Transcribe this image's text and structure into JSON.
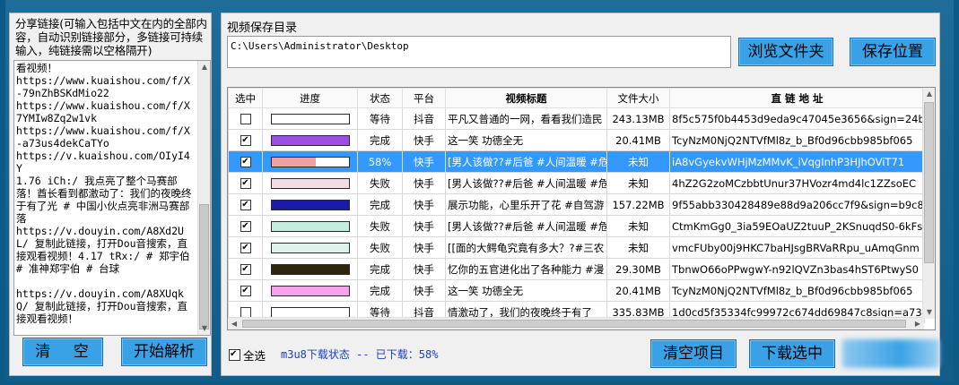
{
  "left": {
    "caption": "分享链接(可输入包括中文在内的全部内容，自动识别链接部分，多链接可持续输入，纯链接需以空格隔开)",
    "text": "看视频！\nhttps://www.kuaishou.com/f/X-79nZhBSKdMio22\nhttps://www.kuaishou.com/f/X7YMIw8Zq2w1vk\nhttps://www.kuaishou.com/f/X-a73us4dekCaTYo\nhttps://v.kuaishou.com/OIyI4Y\n1.76 iCh:/ 我点亮了整个马赛部落！酋长看到都激动了：我们的夜晚终于有了光 # 中国小伙点亮非洲马赛部落\nhttps://v.douyin.com/A8Xd2UL/ 复制此链接，打开Dou音搜索，直接观看视频！4.17 tRx:/ # 郑宇伯 # 准神郑宇伯 # 台球\n\nhttps://v.douyin.com/A8XUqkQ/ 复制此链接，打开Dou音搜索，直接观看视频！",
    "clear_label": "清 空",
    "parse_label": "开始解析"
  },
  "right": {
    "save_label": "视频保存目录",
    "save_path": "C:\\Users\\Administrator\\Desktop",
    "browse_label": "浏览文件夹",
    "savepos_label": "保存位置",
    "columns": [
      "选中",
      "进度",
      "状态",
      "平台",
      "视频标题",
      "文件大小",
      "直 链 地 址"
    ],
    "rows": [
      {
        "checked": false,
        "progress": 0,
        "bar_color": "#f5f5f5",
        "status": "等待",
        "platform": "抖音",
        "title": "平凡又普通的一网，看看我们造民",
        "size": "243.13MB",
        "url": "8f5c575f0b4453d9eda9c47045e3656&sign=24b"
      },
      {
        "checked": true,
        "progress": 100,
        "bar_color": "#9b4fe6",
        "status": "完成",
        "platform": "快手",
        "title": "这一笑 功德全无",
        "size": "20.41MB",
        "url": "TcyNzM0NjQ2NTVfMl8z_b_Bf0d96cbb985bf065"
      },
      {
        "checked": true,
        "progress": 58,
        "bar_color": "#f0a0a0",
        "status": "58%",
        "platform": "快手",
        "title": "[男人该做??#后爸 #人间温暖 #危",
        "size": "未知",
        "url": "iA8vGyekvWHjMzMMvK_iVqgInhP3HJhOViT71",
        "selected": true
      },
      {
        "checked": true,
        "progress": 100,
        "bar_color": "#f0dde6",
        "status": "失败",
        "platform": "快手",
        "title": "[男人该做??#后爸 #人间温暖 #危",
        "size": "未知",
        "url": "4hZ2G2zoMCzbbtUnur37HVozr4md4lc1ZZsoEC"
      },
      {
        "checked": true,
        "progress": 100,
        "bar_color": "#1c1aa8",
        "status": "完成",
        "platform": "快手",
        "title": "展示功能，心里乐开了花 #自驾游",
        "size": "157.22MB",
        "url": "9f55abb330428489e88d9a206cc7f9&sign=b9c8"
      },
      {
        "checked": true,
        "progress": 100,
        "bar_color": "#c4ece0",
        "status": "失败",
        "platform": "快手",
        "title": "[男人该做??#后爸 #人间温暖 #危",
        "size": "未知",
        "url": "CtmKmGg0_3ia59EOaUZ2tuuP_2KSnuqdS0-6kFsa"
      },
      {
        "checked": true,
        "progress": 100,
        "bar_color": "#dff2ea",
        "status": "失败",
        "platform": "快手",
        "title": "[[面的大鳄龟究竟有多大？?#三农",
        "size": "未知",
        "url": "vmcFUby00j9HKC7baHJsgBRVaRRpu_uAmqGnm"
      },
      {
        "checked": true,
        "progress": 100,
        "bar_color": "#2e2410",
        "status": "完成",
        "platform": "快手",
        "title": "忆你的五官进化出了各种能力 #漫",
        "size": "29.30MB",
        "url": "TbnwO66oPPwgwY-n92lQVZn3bas4hST6PtwyS0"
      },
      {
        "checked": true,
        "progress": 100,
        "bar_color": "#f6a0ee",
        "status": "完成",
        "platform": "快手",
        "title": "这一笑 功德全无",
        "size": "20.41MB",
        "url": "TcyNzM0NjQ2NTVfMl8z_b_Bf0d96cbb985bf065"
      },
      {
        "checked": false,
        "progress": 0,
        "bar_color": "#f5f5f5",
        "status": "等待",
        "platform": "抖音",
        "title": "情激动了，我们的夜晚终于有了",
        "size": "335.83MB",
        "url": "1d0cd5f35334fc99972c674dd69847c8sign=a73e"
      }
    ],
    "select_all_label": "全选",
    "status_text": "m3u8下载状态 -- 已下载：58%",
    "clear_items_label": "清空项目",
    "download_label": "下载选中"
  },
  "colors": {
    "accent": "#39a1e6",
    "selection": "#3399ff",
    "frame": "#115c89"
  }
}
